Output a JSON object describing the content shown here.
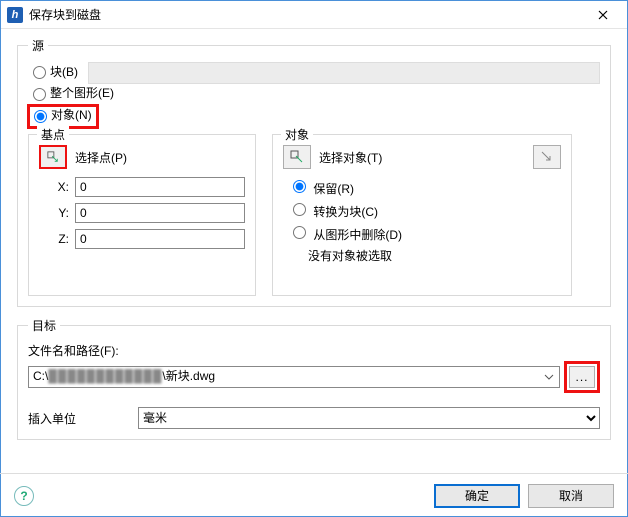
{
  "window": {
    "title": "保存块到磁盘"
  },
  "source": {
    "legend": "源",
    "block_label": "块(B)",
    "drawing_label": "整个图形(E)",
    "objects_label": "对象(N)",
    "selected": "objects"
  },
  "base": {
    "legend": "基点",
    "pick_label": "选择点(P)",
    "x_label": "X:",
    "y_label": "Y:",
    "z_label": "Z:",
    "x": "0",
    "y": "0",
    "z": "0"
  },
  "objects": {
    "legend": "对象",
    "select_label": "选择对象(T)",
    "retain_label": "保留(R)",
    "convert_label": "转换为块(C)",
    "delete_label": "从图形中删除(D)",
    "status": "没有对象被选取",
    "selected": "retain"
  },
  "target": {
    "legend": "目标",
    "path_label": "文件名和路径(F):",
    "path_prefix": "C:\\",
    "path_redacted": "████████████",
    "path_suffix": "\\新块.dwg",
    "units_label": "插入单位",
    "units_value": "毫米"
  },
  "buttons": {
    "ok": "确定",
    "cancel": "取消",
    "browse": "..."
  }
}
